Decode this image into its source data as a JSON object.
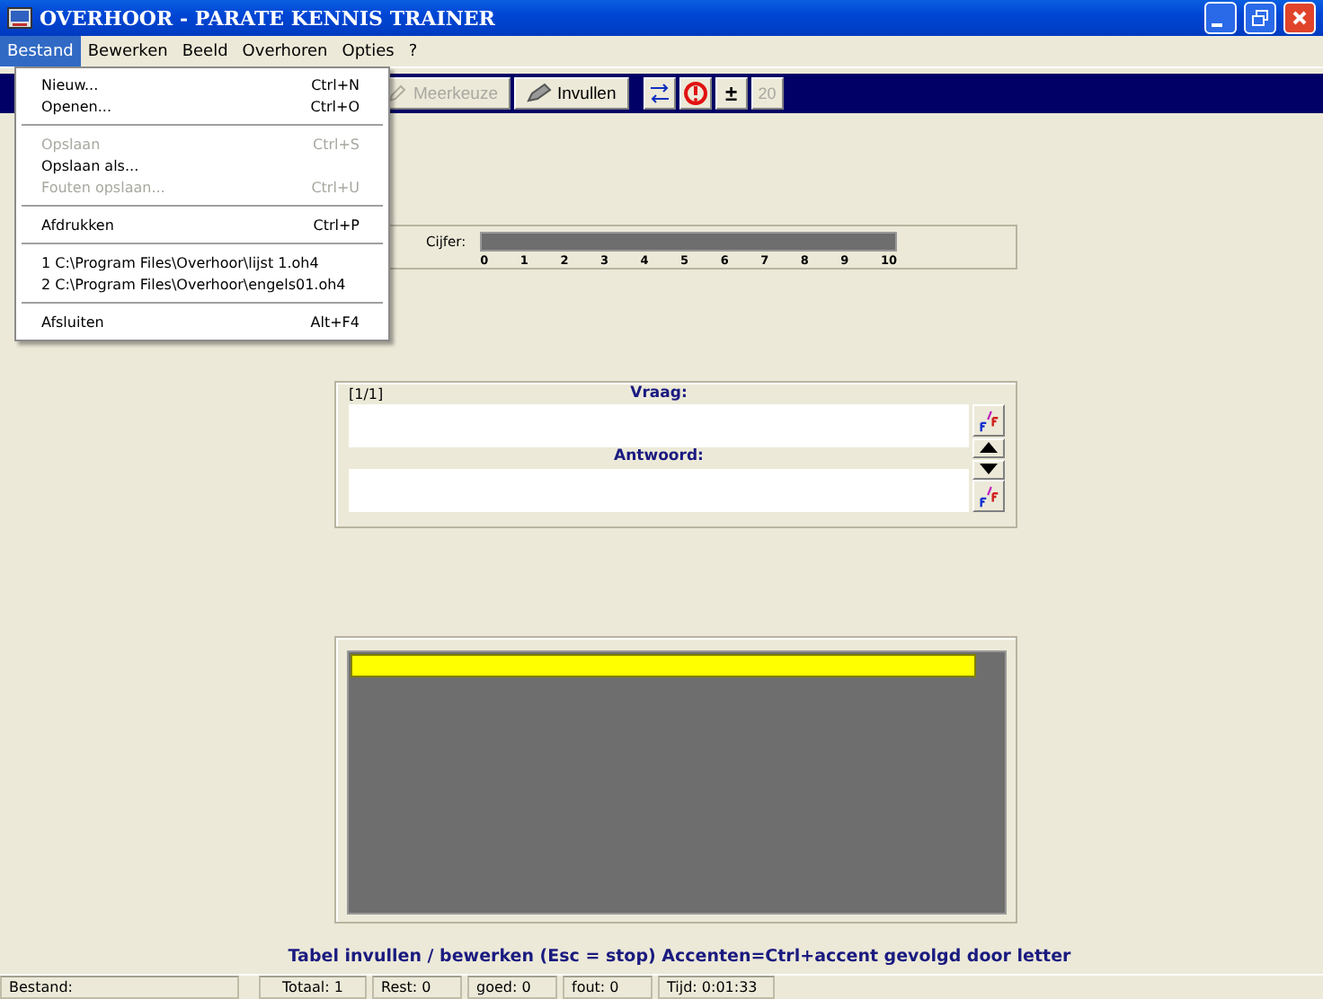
{
  "window": {
    "title": "OVERHOOR - PARATE KENNIS TRAINER"
  },
  "menu_bar": [
    {
      "label": "Bestand",
      "selected": true
    },
    {
      "label": "Bewerken",
      "selected": false
    },
    {
      "label": "Beeld",
      "selected": false
    },
    {
      "label": "Overhoren",
      "selected": false
    },
    {
      "label": "Opties",
      "selected": false
    },
    {
      "label": "?",
      "selected": false
    }
  ],
  "file_menu": [
    {
      "items": [
        {
          "label": "Nieuw...",
          "shortcut": "Ctrl+N",
          "disabled": false
        },
        {
          "label": "Openen...",
          "shortcut": "Ctrl+O",
          "disabled": false
        }
      ]
    },
    {
      "items": [
        {
          "label": "Opslaan",
          "shortcut": "Ctrl+S",
          "disabled": true
        },
        {
          "label": "Opslaan als...",
          "disabled": false
        },
        {
          "label": "Fouten opslaan...",
          "shortcut": "Ctrl+U",
          "disabled": true
        }
      ]
    },
    {
      "items": [
        {
          "label": "Afdrukken",
          "shortcut": "Ctrl+P",
          "disabled": false
        }
      ]
    },
    {
      "items": [
        {
          "label": "1 C:\\Program Files\\Overhoor\\lijst 1.oh4",
          "disabled": false
        },
        {
          "label": "2 C:\\Program Files\\Overhoor\\engels01.oh4",
          "disabled": false
        }
      ]
    },
    {
      "items": [
        {
          "label": "Afsluiten",
          "shortcut": "Alt+F4",
          "disabled": false
        }
      ]
    }
  ],
  "toolbar": {
    "buttons": [
      {
        "label": "Meerkeuze",
        "disabled": true
      },
      {
        "label": "Invullen",
        "disabled": false
      }
    ],
    "small_buttons": [
      {
        "label": "±",
        "disabled": false
      },
      {
        "label": "20",
        "disabled": true
      }
    ]
  },
  "grade": {
    "label": "Cijfer:",
    "ticks": [
      "0",
      "1",
      "2",
      "3",
      "4",
      "5",
      "6",
      "7",
      "8",
      "9",
      "10"
    ]
  },
  "question_panel": {
    "counter": "[1/1]",
    "question_label": "Vraag:",
    "answer_label": "Antwoord:"
  },
  "progress": {
    "level": 0.96
  },
  "help_text": "Tabel invullen / bewerken (Esc = stop) Accenten=Ctrl+accent gevolgd door letter",
  "status_bar": [
    "Bestand:",
    "Totaal: 1",
    "Rest: 0",
    "goed: 0",
    "fout: 0",
    "Tijd: 0:01:33"
  ]
}
